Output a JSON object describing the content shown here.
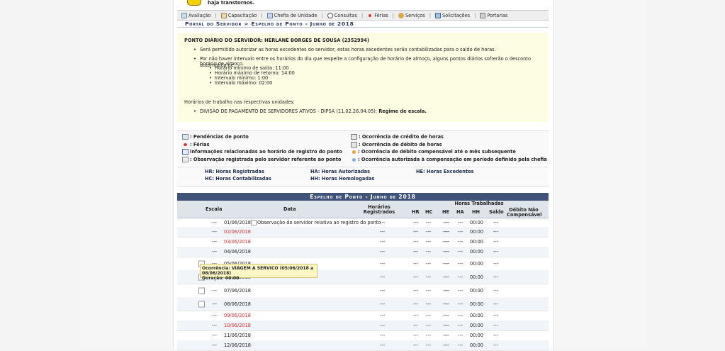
{
  "notice": "haja transtornos.",
  "nav": [
    {
      "label": "Avaliação",
      "icon": "avaliacao-icon"
    },
    {
      "label": "Capacitação",
      "icon": "capacitacao-icon"
    },
    {
      "label": "Chefia de Unidade",
      "icon": "chefia-icon"
    },
    {
      "label": "Consultas",
      "icon": "consultas-icon"
    },
    {
      "label": "Férias",
      "icon": "ferias-icon"
    },
    {
      "label": "Serviços",
      "icon": "servicos-icon"
    },
    {
      "label": "Solicitações",
      "icon": "solicitacoes-icon"
    },
    {
      "label": "Portarias",
      "icon": "portarias-icon"
    }
  ],
  "breadcrumb": "Portal do Servidor > Espelho de Ponto - Junho de 2018",
  "info": {
    "title": "PONTO DIÁRIO DO SERVIDOR: HERLANE BORGES DE SOUSA (2352994)",
    "bullet1": "Será permitido autorizar as horas excedentes do servidor, estas horas excedentes serão contabilizadas para o saldo de horas.",
    "bullet2_line1": "Por não haver intervalo entre os horários do dia que respeite a configuração de horário de almoço, alguns pontos diários sofrerão o desconto automático de",
    "bullet2_line2": "horário de almoço.",
    "sub": [
      "Horário mínimo de saída: 11:00",
      "Horário máximo de retorno: 14:00",
      "Intervalo mínimo: 1:00",
      "Intervalo máximo: 02:00"
    ],
    "units_label": "Horários de trabalho nas respectivas unidades:",
    "unit": "DIVISÃO DE PAGAMENTO DE SERVIDORES ATIVOS - DIPSA (11.02.26.04.05):",
    "regime": "Regime de escala."
  },
  "legend": {
    "pendencias": ": Pendências de ponto",
    "ferias": ": Férias",
    "info": "Informações relacionadas ao horário de registro do ponto",
    "obs": ": Observação registrada pelo servidor referente ao ponto",
    "credito": ": Ocorrência de crédito de horas",
    "debito": ": Ocorrência de débito de horas",
    "debito_comp": ": Ocorrência de débito compensável até o mês subsequente",
    "autorizada": ": Ocorrência autorizada à compensação em período definido pela chefia",
    "dot1_color": "#f0a040",
    "dot2_color": "#7fb0e0"
  },
  "abbr": {
    "hr": "HR: Horas Registradas",
    "hc": "HC: Horas Contabilizadas",
    "ha": "HA: Horas Autorizadas",
    "hh": "HH: Horas Homologadas",
    "he": "HE: Horas Excedentes"
  },
  "table": {
    "title": "Espelho de Ponto - Junho de 2018",
    "headers": {
      "escala": "Escala",
      "data": "Data",
      "horarios": "Horários Registrados",
      "horas": "Horas Trabalhadas",
      "hr": "HR",
      "hc": "HC",
      "he": "HE",
      "ha": "HA",
      "hh": "HH",
      "saldo": "Saldo",
      "debito": "Débito Não Compensável"
    },
    "obs_text": "Observação do servidor relativa ao registro do ponto",
    "rows": [
      {
        "escala": "---",
        "data": "01/06/2018",
        "horarios": "---",
        "hr": "---",
        "hc": "---",
        "he": "---",
        "ha": "---",
        "hh": "---",
        "saldo": "00:00",
        "debito": "---"
      },
      {
        "escala": "---",
        "data": "02/06/2018",
        "horarios": "---",
        "hr": "---",
        "hc": "---",
        "he": "---",
        "ha": "---",
        "hh": "---",
        "saldo": "00:00",
        "debito": "---"
      },
      {
        "escala": "---",
        "data": "03/06/2018",
        "horarios": "---",
        "hr": "---",
        "hc": "---",
        "he": "---",
        "ha": "---",
        "hh": "---",
        "saldo": "00:00",
        "debito": "---"
      },
      {
        "escala": "---",
        "data": "04/06/2018",
        "horarios": "---",
        "hr": "---",
        "hc": "---",
        "he": "---",
        "ha": "---",
        "hh": "---",
        "saldo": "00:00",
        "debito": "---"
      },
      {
        "escala": "---",
        "data": "05/06/2018",
        "horarios": "---",
        "hr": "---",
        "hc": "---",
        "he": "---",
        "ha": "---",
        "hh": "---",
        "saldo": "00:00",
        "debito": "---"
      },
      {
        "escala": "---",
        "data": "06/06/2018",
        "horarios": "---",
        "hr": "---",
        "hc": "---",
        "he": "---",
        "ha": "---",
        "hh": "---",
        "saldo": "00:00",
        "debito": "---"
      },
      {
        "escala": "---",
        "data": "07/06/2018",
        "horarios": "---",
        "hr": "---",
        "hc": "---",
        "he": "---",
        "ha": "---",
        "hh": "---",
        "saldo": "00:00",
        "debito": "---"
      },
      {
        "escala": "---",
        "data": "08/06/2018",
        "horarios": "---",
        "hr": "---",
        "hc": "---",
        "he": "---",
        "ha": "---",
        "hh": "---",
        "saldo": "00:00",
        "debito": "---"
      },
      {
        "escala": "---",
        "data": "09/06/2018",
        "horarios": "---",
        "hr": "---",
        "hc": "---",
        "he": "---",
        "ha": "---",
        "hh": "---",
        "saldo": "00:00",
        "debito": "---"
      },
      {
        "escala": "---",
        "data": "10/06/2018",
        "horarios": "---",
        "hr": "---",
        "hc": "---",
        "he": "---",
        "ha": "---",
        "hh": "---",
        "saldo": "00:00",
        "debito": "---"
      },
      {
        "escala": "---",
        "data": "11/06/2018",
        "horarios": "---",
        "hr": "---",
        "hc": "---",
        "he": "---",
        "ha": "---",
        "hh": "---",
        "saldo": "00:00",
        "debito": "---"
      },
      {
        "escala": "---",
        "data": "12/06/2018",
        "horarios": "---",
        "hr": "---",
        "hc": "---",
        "he": "---",
        "ha": "---",
        "hh": "---",
        "saldo": "00:00",
        "debito": "---"
      }
    ]
  },
  "tooltip": {
    "line1": "Ocorrência: VIAGEM A SERVICO (05/06/2018 a 08/06/2018)",
    "line2": "Duração: 00:00"
  }
}
